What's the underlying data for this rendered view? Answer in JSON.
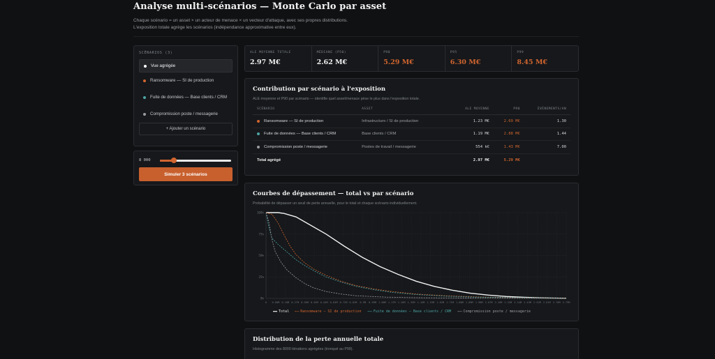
{
  "header": {
    "title": "Analyse multi-scénarios — Monte Carlo par asset",
    "subtitle_line1": "Chaque scénario = un asset × un acteur de menace × un vecteur d'attaque, avec ses propres distributions.",
    "subtitle_line2": "L'exposition totale agrège les scénarios (indépendance approximative entre eux)."
  },
  "sidebar": {
    "heading": "SCÉNARIOS (3)",
    "items": [
      {
        "label": "Vue agrégée",
        "color": "#ffffff",
        "active": true
      },
      {
        "label": "Ransomware — SI de production",
        "color": "#d2652f",
        "active": false
      },
      {
        "label": "Fuite de données — Base clients / CRM",
        "color": "#4ea5a5",
        "active": false
      },
      {
        "label": "Compromission poste / messagerie",
        "color": "#9a9ca0",
        "active": false
      }
    ],
    "add_label": "+ Ajouter un scénario"
  },
  "simulation": {
    "iterations_label": "8 000",
    "slider_fraction": 0.2,
    "button_label": "Simuler 3 scénarios"
  },
  "kpis": [
    {
      "label": "ALE MOYENNE TOTALE",
      "value": "2.97 M€",
      "color": "#f2f2f2"
    },
    {
      "label": "MÉDIANE (P50)",
      "value": "2.62 M€",
      "color": "#f2f2f2"
    },
    {
      "label": "P90",
      "value": "5.29 M€",
      "color": "#d2652f"
    },
    {
      "label": "P95",
      "value": "6.30 M€",
      "color": "#d2652f"
    },
    {
      "label": "P99",
      "value": "8.45 M€",
      "color": "#d2652f"
    }
  ],
  "contribution": {
    "title": "Contribution par scénario à l'exposition",
    "subtitle": "ALE moyenne et P90 par scénario — identifie quel asset/menace pèse le plus dans l'exposition totale.",
    "columns": [
      "SCÉNARIO",
      "ASSET",
      "ALE MOYENNE",
      "P90",
      "ÉVÉNEMENTS/AN"
    ],
    "rows": [
      {
        "scenario": "Ransomware — SI de production",
        "color": "#d2652f",
        "asset": "Infrastructure / SI de production",
        "ale": "1.23 M€",
        "p90": "2.69 M€",
        "events": "1.30"
      },
      {
        "scenario": "Fuite de données — Base clients / CRM",
        "color": "#4ea5a5",
        "asset": "Base clients / CRM",
        "ale": "1.19 M€",
        "p90": "2.88 M€",
        "events": "1.44"
      },
      {
        "scenario": "Compromission poste / messagerie",
        "color": "#9a9ca0",
        "asset": "Postes de travail / messagerie",
        "ale": "554 k€",
        "p90": "1.43 M€",
        "events": "7.00"
      }
    ],
    "total": {
      "label": "Total agrégé",
      "ale": "2.97 M€",
      "p90": "5.29 M€"
    },
    "p90_color": "#d2652f"
  },
  "exceedance": {
    "title": "Courbes de dépassement — total vs par scénario",
    "subtitle": "Probabilité de dépasser un seuil de perte annuelle, pour le total et chaque scénario individuellement."
  },
  "chart_data": {
    "type": "line",
    "x_ticks": [
      "0",
      "0.00M",
      "0.18M",
      "0.27M",
      "0.36M",
      "0.45M",
      "0.54M",
      "0.63M",
      "0.72M",
      "0.81M",
      "0.9M",
      "0.99M",
      "1.08M",
      "1.17M",
      "1.26M",
      "1.35M",
      "1.44M",
      "1.53M",
      "1.62M",
      "1.71M",
      "1.80M",
      "1.89M",
      "1.98M",
      "2.07M",
      "2.16M",
      "2.25M",
      "2.34M",
      "2.43M",
      "2.52M",
      "2.61M",
      "2.70M",
      "2.79M"
    ],
    "y_ticks": [
      "0%",
      "25%",
      "50%",
      "75%",
      "100%"
    ],
    "ylim": [
      0,
      100
    ],
    "x_domain": [
      0,
      1
    ],
    "series": [
      {
        "name": "Total",
        "color": "#f2f2f2",
        "dashed": false,
        "x": [
          0,
          0.04,
          0.06,
          0.1,
          0.14,
          0.2,
          0.26,
          0.32,
          0.38,
          0.44,
          0.5,
          0.56,
          0.62,
          0.68,
          0.74,
          0.8,
          0.86,
          0.92,
          1.0
        ],
        "y": [
          100,
          100,
          99,
          95,
          87,
          75,
          61,
          48,
          37,
          28,
          20,
          14,
          9.5,
          6,
          3.8,
          2.2,
          1.2,
          0.6,
          0.2
        ]
      },
      {
        "name": "Ransomware — SI de production",
        "color": "#d2652f",
        "dashed": true,
        "x": [
          0,
          0.02,
          0.04,
          0.06,
          0.08,
          0.1,
          0.13,
          0.16,
          0.2,
          0.25,
          0.3,
          0.36,
          0.42,
          0.5,
          0.6,
          0.7,
          0.8,
          1.0
        ],
        "y": [
          100,
          98,
          88,
          74,
          61,
          51,
          41,
          34,
          27,
          20,
          15,
          11,
          8,
          5,
          3,
          1.8,
          1,
          0.3
        ]
      },
      {
        "name": "Fuite de données — Base clients / CRM",
        "color": "#4ea5a5",
        "dashed": true,
        "x": [
          0,
          0.01,
          0.02,
          0.04,
          0.06,
          0.08,
          0.1,
          0.13,
          0.16,
          0.2,
          0.25,
          0.3,
          0.36,
          0.42,
          0.5,
          0.6,
          0.7,
          1.0
        ],
        "y": [
          100,
          82,
          70,
          63,
          57,
          51,
          45,
          38,
          32,
          25,
          19,
          14,
          10,
          7,
          4.5,
          2.5,
          1.5,
          0.3
        ]
      },
      {
        "name": "Compromission poste / messagerie",
        "color": "#9a9ca0",
        "dashed": true,
        "x": [
          0,
          0.01,
          0.02,
          0.03,
          0.05,
          0.07,
          0.1,
          0.13,
          0.16,
          0.2,
          0.25,
          0.3,
          0.4,
          0.5,
          0.6,
          1.0
        ],
        "y": [
          100,
          88,
          68,
          55,
          42,
          33,
          24,
          17,
          12,
          8,
          5,
          3,
          1.5,
          0.8,
          0.4,
          0.1
        ]
      }
    ]
  },
  "distribution": {
    "title": "Distribution de la perte annuelle totale",
    "subtitle": "Histogramme des 8000 itérations agrégées (tronqué au P99)."
  }
}
